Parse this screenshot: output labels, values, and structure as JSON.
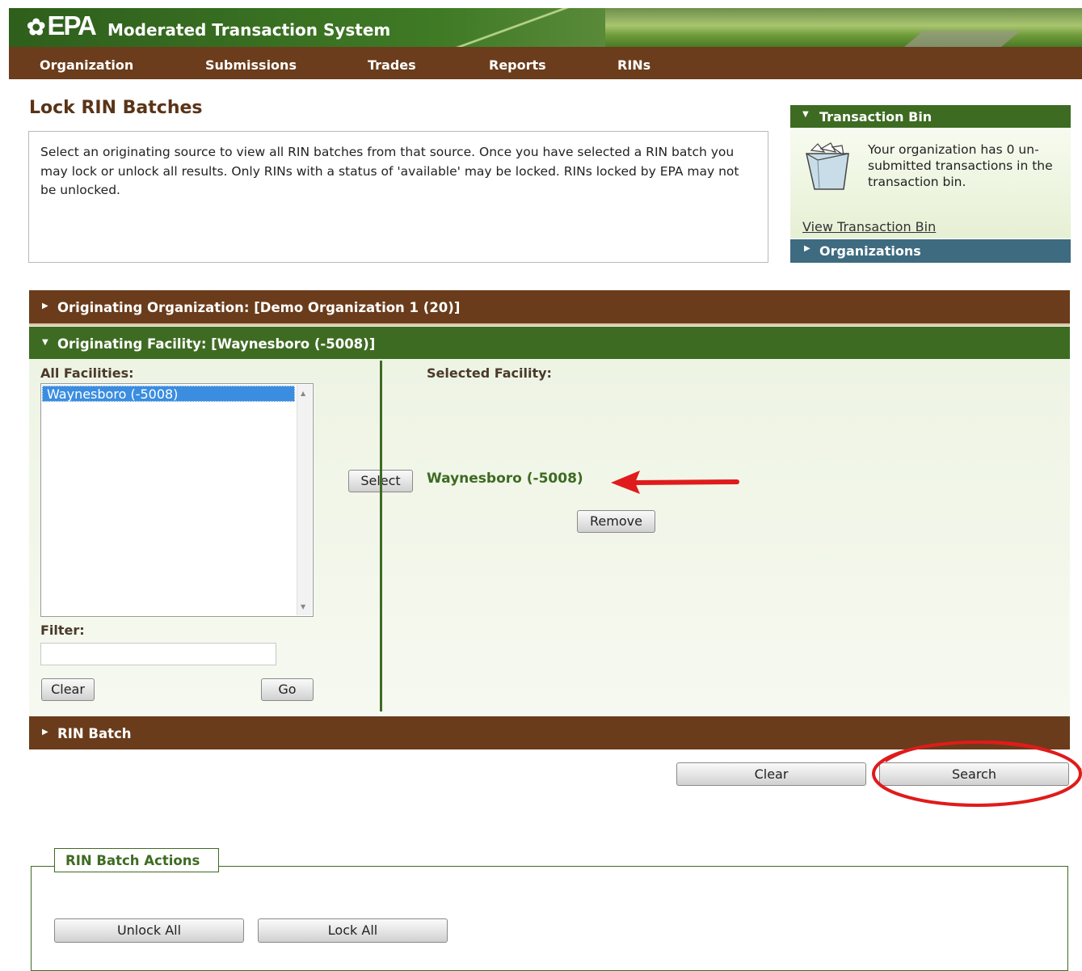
{
  "header": {
    "logo_text": "EPA",
    "app_title": "Moderated Transaction System"
  },
  "nav": {
    "items": [
      "Organization",
      "Submissions",
      "Trades",
      "Reports",
      "RINs"
    ]
  },
  "page": {
    "title": "Lock RIN Batches",
    "intro": "Select an originating source to view all RIN batches from that source. Once you have selected a RIN batch you may  lock or unlock all results. Only RINs with a status of 'available' may be locked. RINs locked by EPA may not be unlocked."
  },
  "transaction_bin": {
    "header": "Transaction Bin",
    "message": "Your organization has 0 un-submitted transactions in the transaction bin.",
    "link": "View Transaction Bin",
    "icon": "bin-icon"
  },
  "organizations_panel": {
    "header": "Organizations"
  },
  "originating_organization": {
    "header": "Originating Organization: [Demo Organization 1 (20)]"
  },
  "originating_facility": {
    "header": "Originating Facility: [Waynesboro (-5008)]",
    "all_facilities_label": "All Facilities:",
    "list_items": [
      "Waynesboro (-5008)"
    ],
    "filter_label": "Filter:",
    "filter_value": "",
    "clear_label": "Clear",
    "go_label": "Go",
    "select_label": "Select",
    "selected_label": "Selected Facility:",
    "selected_value": "Waynesboro (-5008)",
    "remove_label": "Remove"
  },
  "rin_batch": {
    "header": "RIN Batch",
    "clear_label": "Clear",
    "search_label": "Search"
  },
  "actions": {
    "title": "RIN Batch Actions",
    "unlock_label": "Unlock All",
    "lock_label": "Lock All"
  },
  "colors": {
    "brown": "#6a3c1b",
    "green": "#3e6b22",
    "annotation_red": "#e01b1b"
  }
}
